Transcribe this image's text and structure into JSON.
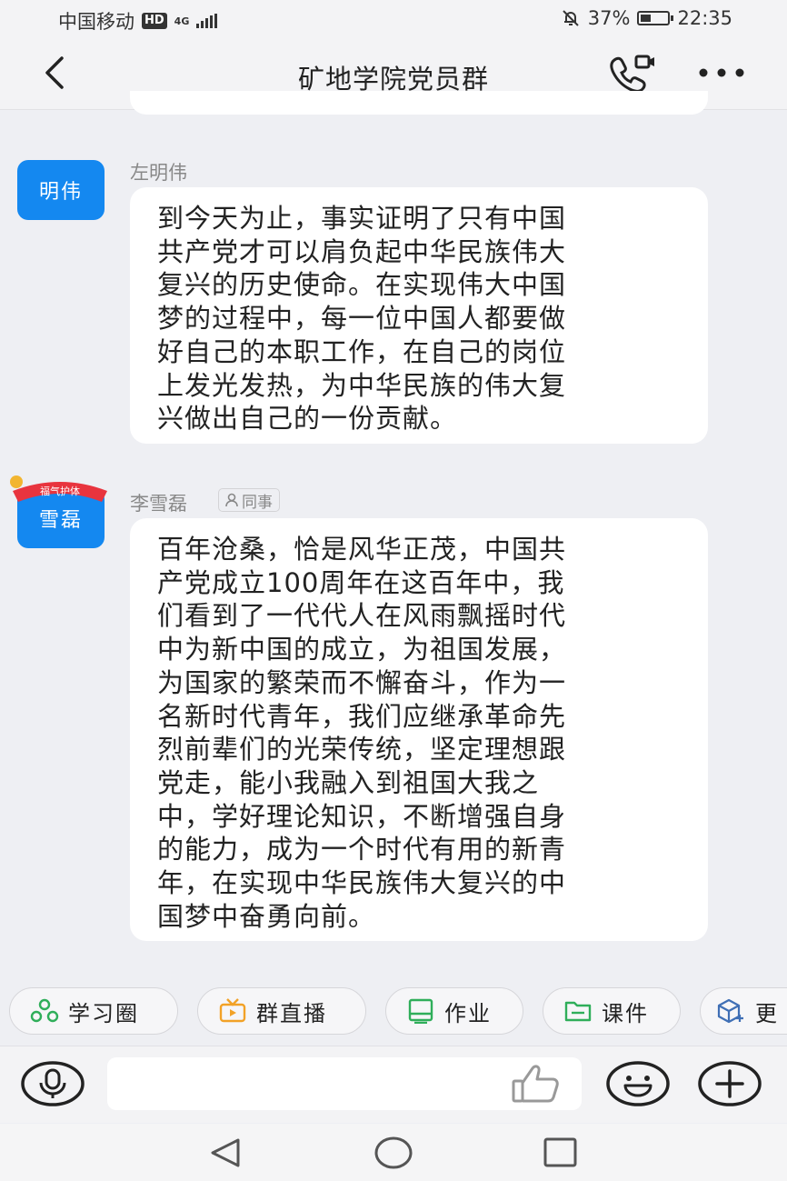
{
  "status_bar": {
    "carrier": "中国移动",
    "hd": "HD",
    "network": "4G",
    "battery_percent_text": "37%",
    "battery_level": 0.37,
    "time": "22:35"
  },
  "header": {
    "title": "矿地学院党员群",
    "back_icon": "back-arrow-icon",
    "call_icon": "phone-video-icon",
    "more_icon": "more-dots-icon"
  },
  "messages": [
    {
      "avatar_text": "明伟",
      "sender": "左明伟",
      "lines": [
        "到今天为止，事实证明了只有中国",
        "共产党才可以肩负起中华民族伟大",
        "复兴的历史使命。在实现伟大中国",
        "梦的过程中，每一位中国人都要做",
        "好自己的本职工作，在自己的岗位",
        "上发光发热，为中华民族的伟大复",
        "兴做出自己的一份贡献。"
      ]
    },
    {
      "avatar_text": "雪磊",
      "sender": "李雪磊",
      "tag": "同事",
      "avatar_decoration_text": "福气护体",
      "lines": [
        "百年沧桑，恰是风华正茂，中国共",
        "产党成立100周年在这百年中，我",
        "们看到了一代代人在风雨飘摇时代",
        "中为新中国的成立，为祖国发展，",
        "为国家的繁荣而不懈奋斗，作为一",
        "名新时代青年，我们应继承革命先",
        "烈前辈们的光荣传统，坚定理想跟",
        "党走，能小我融入到祖国大我之",
        "中，学好理论知识，不断增强自身",
        "的能力，成为一个时代有用的新青",
        "年，在实现中华民族伟大复兴的中",
        "国梦中奋勇向前。"
      ]
    }
  ],
  "quick_actions": [
    {
      "label": "学习圈",
      "icon": "study-circle-icon",
      "color": "#2fae5a"
    },
    {
      "label": "群直播",
      "icon": "live-tv-icon",
      "color": "#f2a227"
    },
    {
      "label": "作业",
      "icon": "homework-icon",
      "color": "#2fae5a"
    },
    {
      "label": "课件",
      "icon": "folder-icon",
      "color": "#2fae5a"
    },
    {
      "label": "更",
      "icon": "cube-add-icon",
      "color": "#3f6fb5"
    }
  ],
  "input_bar": {
    "placeholder": "",
    "voice_icon": "microphone-icon",
    "like_icon": "thumbs-up-icon",
    "emoji_icon": "smile-icon",
    "add_icon": "plus-icon"
  },
  "system_nav": {
    "back": "triangle-back-icon",
    "home": "circle-home-icon",
    "recents": "square-recents-icon"
  },
  "colors": {
    "background": "#eeeff3",
    "avatar": "#1488f0",
    "bubble": "#ffffff"
  }
}
